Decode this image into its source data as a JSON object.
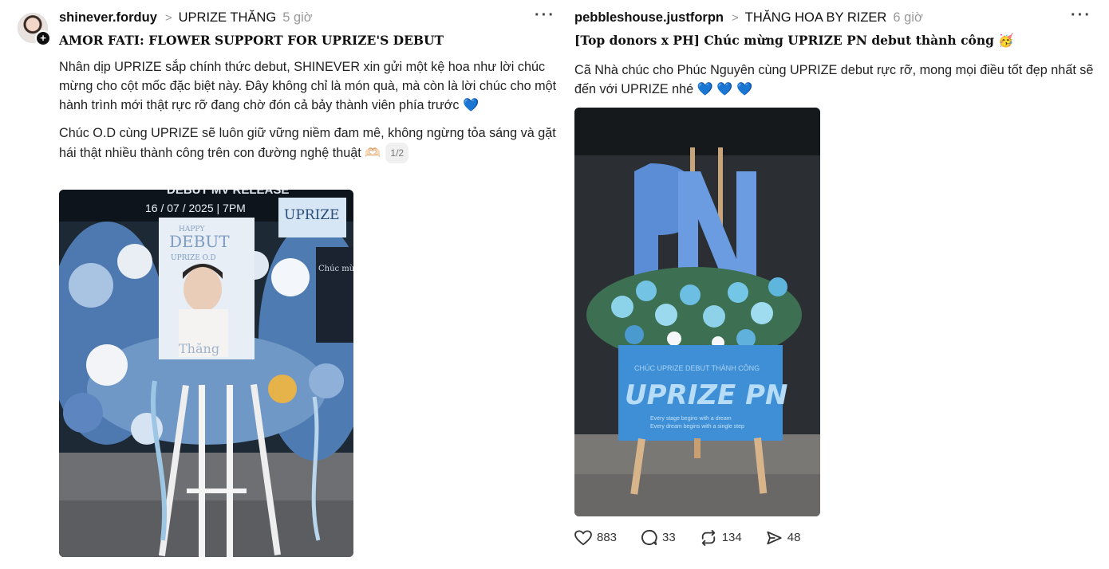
{
  "post_left": {
    "username": "shinever.forduy",
    "topic": "UPRIZE THĂNG",
    "time": "5 giờ",
    "title": "AMOR FATI: FLOWER SUPPORT FOR UPRIZE'S DEBUT",
    "paragraph1": "Nhân dịp UPRIZE sắp chính thức debut, SHINEVER xin gửi một kệ hoa như lời chúc mừng cho cột mốc đặc biệt này. Đây không chỉ là món quà, mà còn là lời chúc cho một hành trình mới thật rực rỡ đang chờ đón cả bảy thành viên phía trước 💙",
    "paragraph2": "Chúc O.D cùng UPRIZE sẽ luôn giữ vững niềm đam mê, không ngừng tỏa sáng và gặt hái thật nhiều thành công trên con đường nghệ thuật 🫶🏻",
    "image_counter": "1/2",
    "photo_texts": {
      "banner": "DEBUT MV RELEASE",
      "date": "16 / 07 / 2025 | 7PM",
      "poster_top": "HAPPY",
      "poster_main": "DEBUT",
      "poster_sub": "UPRIZE O.D",
      "poster_name": "Thăng",
      "side_sign": "UPRIZE",
      "side_sign2": "Chúc mừng UPRIZE DEBUT"
    }
  },
  "post_right": {
    "username": "pebbleshouse.justforpn",
    "topic": "THĂNG HOA BY RIZER",
    "time": "6 giờ",
    "title": "[Top donors x PH] Chúc mừng UPRIZE PN debut thành công 🥳",
    "paragraph1": "Cã Nhà chúc cho Phúc Nguyên cùng UPRIZE debut rực rỡ, mong mọi điều tốt đẹp nhất sẽ đến với UPRIZE nhé 💙 💙 💙",
    "photo_texts": {
      "sign_top": "CHÚC UPRIZE DEBUT THÀNH CÔNG",
      "sign_main": "UPRIZE PN",
      "sign_line1": "Every stage begins with a dream",
      "sign_line2": "Every dream begins with a single step",
      "letters": "PN"
    },
    "actions": {
      "likes": "883",
      "comments": "33",
      "reposts": "134",
      "shares": "48"
    }
  },
  "more_label": "···",
  "icons": [
    "plus-icon",
    "chevron-right-icon",
    "more-icon",
    "heart-icon",
    "comment-icon",
    "repost-icon",
    "share-icon"
  ]
}
